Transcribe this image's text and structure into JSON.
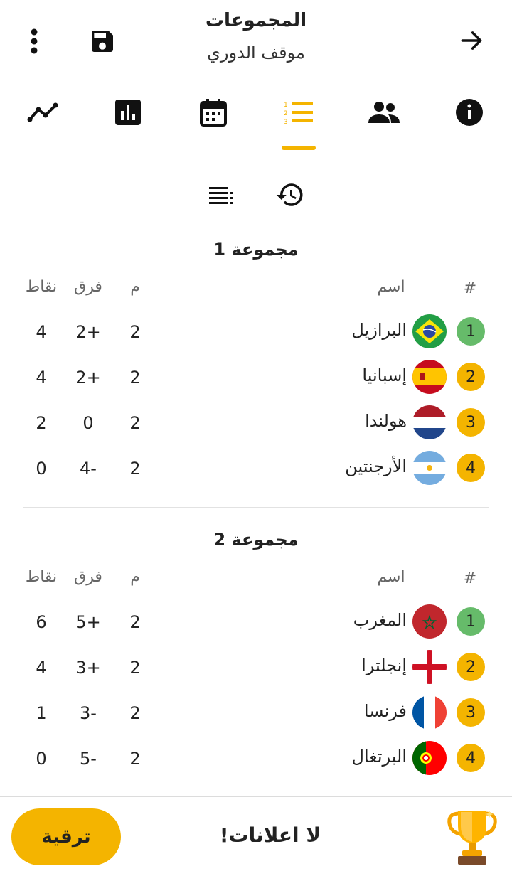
{
  "header": {
    "title": "المجموعات",
    "subtitle": "موقف الدوري"
  },
  "tabs": [
    {
      "icon": "trend-line-icon"
    },
    {
      "icon": "bar-chart-icon"
    },
    {
      "icon": "calendar-icon"
    },
    {
      "icon": "standings-list-icon",
      "active": true
    },
    {
      "icon": "teams-icon"
    },
    {
      "icon": "info-icon"
    }
  ],
  "subtoolbar": {
    "icons": [
      "sort-list-icon",
      "history-icon"
    ]
  },
  "columns": {
    "rank": "#",
    "name": "اسم",
    "played": "م",
    "diff": "فرق",
    "points": "نقاط"
  },
  "groups": [
    {
      "title": "مجموعة 1",
      "rows": [
        {
          "rank": "1",
          "team": "البرازيل",
          "played": "2",
          "diff": "2+",
          "points": "4",
          "rank_color": "#66BB6A",
          "flag": "brazil"
        },
        {
          "rank": "2",
          "team": "إسبانيا",
          "played": "2",
          "diff": "2+",
          "points": "4",
          "rank_color": "#F4B400",
          "flag": "spain"
        },
        {
          "rank": "3",
          "team": "هولندا",
          "played": "2",
          "diff": "0",
          "points": "2",
          "rank_color": "#F4B400",
          "flag": "netherlands"
        },
        {
          "rank": "4",
          "team": "الأرجنتين",
          "played": "2",
          "diff": "4-",
          "points": "0",
          "rank_color": "#F4B400",
          "flag": "argentina"
        }
      ]
    },
    {
      "title": "مجموعة 2",
      "rows": [
        {
          "rank": "1",
          "team": "المغرب",
          "played": "2",
          "diff": "5+",
          "points": "6",
          "rank_color": "#66BB6A",
          "flag": "morocco"
        },
        {
          "rank": "2",
          "team": "إنجلترا",
          "played": "2",
          "diff": "3+",
          "points": "4",
          "rank_color": "#F4B400",
          "flag": "england"
        },
        {
          "rank": "3",
          "team": "فرنسا",
          "played": "2",
          "diff": "3-",
          "points": "1",
          "rank_color": "#F4B400",
          "flag": "france"
        },
        {
          "rank": "4",
          "team": "البرتغال",
          "played": "2",
          "diff": "5-",
          "points": "0",
          "rank_color": "#F4B400",
          "flag": "portugal"
        }
      ]
    }
  ],
  "footer": {
    "upgrade_label": "ترقية",
    "no_ads": "لا اعلانات!",
    "icon": "trophy-icon"
  },
  "colors": {
    "accent": "#F4B400",
    "green": "#66BB6A"
  }
}
